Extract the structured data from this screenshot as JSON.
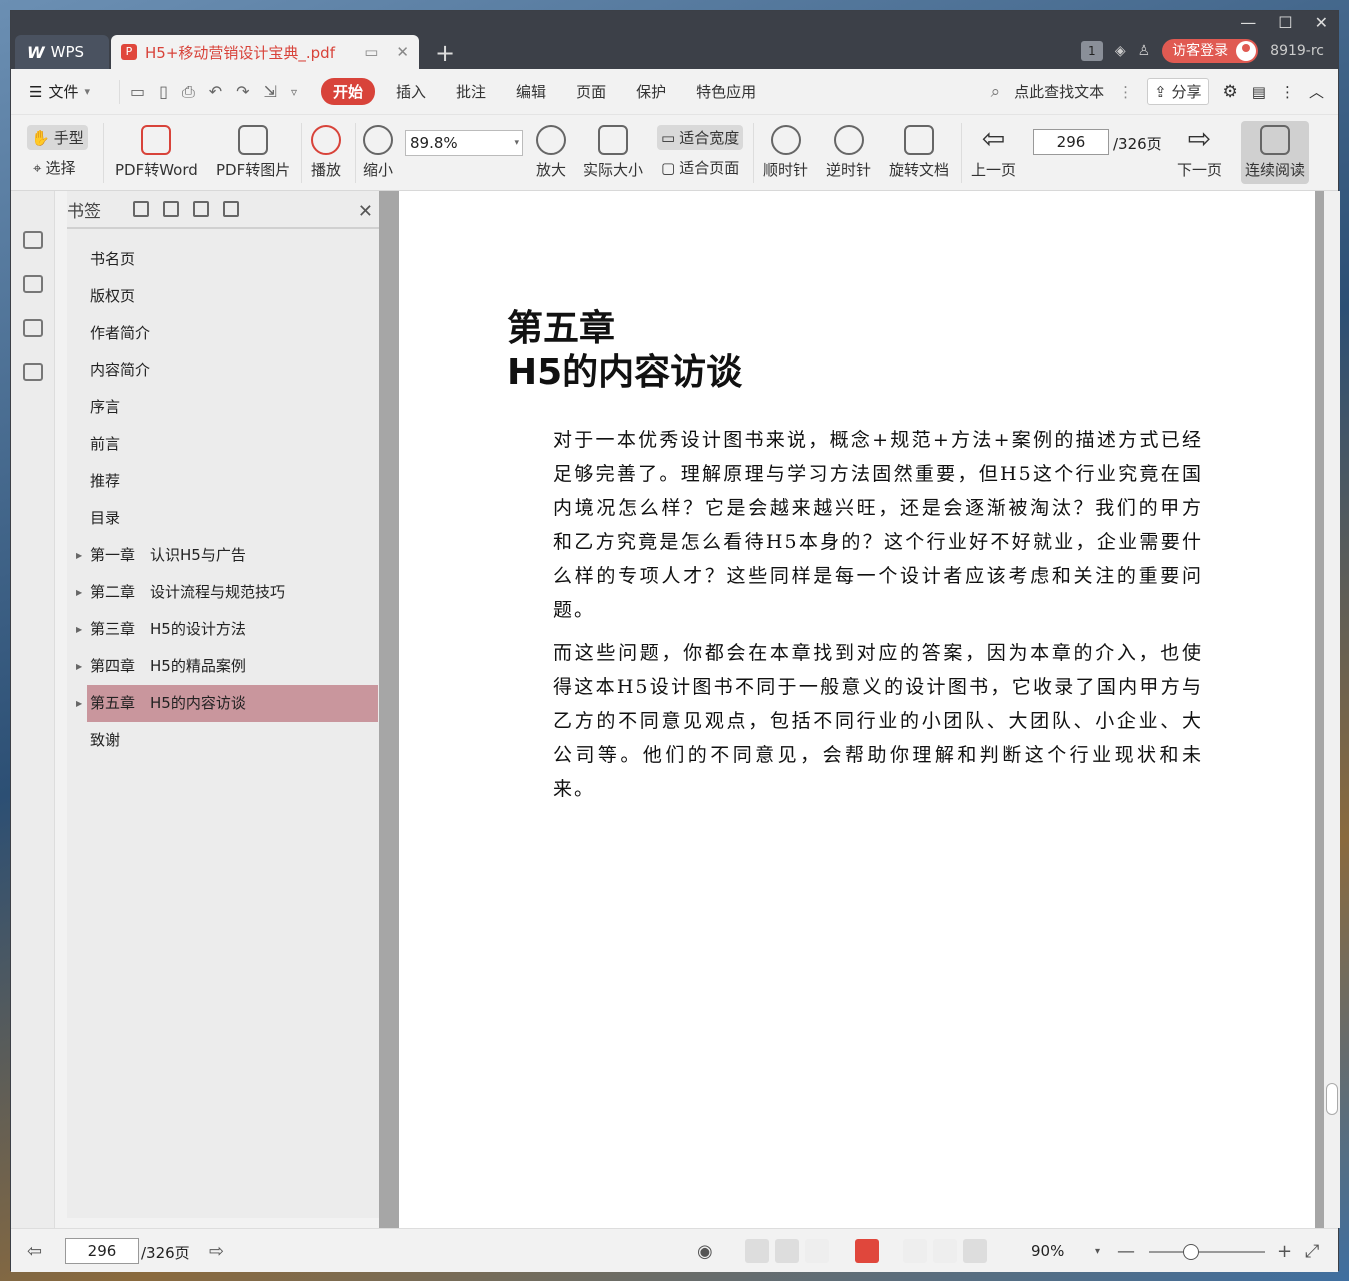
{
  "titlebar": {
    "app_tab_label": "WPS",
    "doc_tab_title": "H5+移动营销设计宝典_.pdf",
    "add_tab_symbol": "+",
    "badge_count": "1",
    "login_label": "访客登录",
    "user_label": "8919-rc"
  },
  "menubar": {
    "file_label": "文件",
    "items": [
      "开始",
      "插入",
      "批注",
      "编辑",
      "页面",
      "保护",
      "特色应用"
    ],
    "search_placeholder": "点此查找文本",
    "share_label": "分享"
  },
  "ribbon": {
    "hand_label": "手型",
    "select_label": "选择",
    "pdf_to_word": "PDF转Word",
    "pdf_to_image": "PDF转图片",
    "play_label": "播放",
    "zoom_out_label": "缩小",
    "zoom_value": "89.8%",
    "zoom_in_label": "放大",
    "actual_size_label": "实际大小",
    "fit_width_label": "适合宽度",
    "fit_page_label": "适合页面",
    "clockwise_label": "顺时针",
    "counterclockwise_label": "逆时针",
    "rotate_doc_label": "旋转文档",
    "prev_page_label": "上一页",
    "current_page": "296",
    "total_pages": "/326页",
    "next_page_label": "下一页",
    "continuous_label": "连续阅读"
  },
  "bookmarks": {
    "title": "书签",
    "items": [
      {
        "label": "书名页"
      },
      {
        "label": "版权页"
      },
      {
        "label": "作者简介"
      },
      {
        "label": "内容简介"
      },
      {
        "label": "序言"
      },
      {
        "label": "前言"
      },
      {
        "label": "推荐"
      },
      {
        "label": "目录"
      },
      {
        "label": "第一章　认识H5与广告"
      },
      {
        "label": "第二章　设计流程与规范技巧"
      },
      {
        "label": "第三章　H5的设计方法"
      },
      {
        "label": "第四章　H5的精品案例"
      },
      {
        "label": "第五章　H5的内容访谈"
      },
      {
        "label": "致谢"
      }
    ]
  },
  "document": {
    "chapter_line1": "第五章",
    "chapter_line2": "H5的内容访谈",
    "paragraph1": "对于一本优秀设计图书来说，概念+规范+方法+案例的描述方式已经足够完善了。理解原理与学习方法固然重要，但H5这个行业究竟在国内境况怎么样？它是会越来越兴旺，还是会逐渐被淘汰？我们的甲方和乙方究竟是怎么看待H5本身的？这个行业好不好就业，企业需要什么样的专项人才？这些同样是每一个设计者应该考虑和关注的重要问题。",
    "paragraph2": "而这些问题，你都会在本章找到对应的答案，因为本章的介入，也使得这本H5设计图书不同于一般意义的设计图书，它收录了国内甲方与乙方的不同意见观点，包括不同行业的小团队、大团队、小企业、大公司等。他们的不同意见，会帮助你理解和判断这个行业现状和未来。"
  },
  "statusbar": {
    "current_page": "296",
    "total_pages": "/326页",
    "zoom_value": "90%",
    "zoom_level": 0.36
  },
  "colors": {
    "accent": "#d8433a",
    "selected_bookmark": "#c9969d"
  }
}
